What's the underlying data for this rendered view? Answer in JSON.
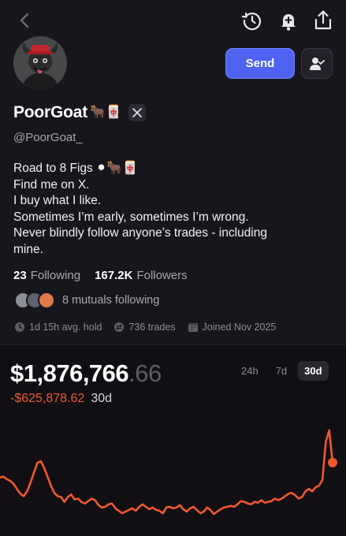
{
  "header": {
    "back_icon": "chevron-left-icon",
    "icons": [
      "history-icon",
      "bell-plus-icon",
      "share-icon"
    ]
  },
  "profile": {
    "display_name": "PoorGoat",
    "name_emojis": "🐂🀄",
    "handle": "@PoorGoat_",
    "bio": {
      "line1_text": "Road to 8 Figs",
      "line1_emojis": "⚫🐂🀄",
      "line2": "Find me on X.",
      "line3": "I buy what I like.",
      "line4": "Sometimes I’m early, sometimes I’m wrong.",
      "line5": "Never blindly follow anyone’s trades - including",
      "line6": "mine."
    },
    "following_count": "23",
    "following_label": "Following",
    "followers_count": "167.2K",
    "followers_label": "Followers",
    "mutuals_text": "8 mutuals following",
    "avg_hold": "1d 15h avg. hold",
    "trades": "736 trades",
    "joined": "Joined Nov 2025"
  },
  "actions": {
    "send_label": "Send"
  },
  "portfolio": {
    "balance_main": "$1,876,766",
    "balance_cents": ".66",
    "pnl_value": "-$625,878.62",
    "pnl_period": "30d",
    "ranges": [
      "24h",
      "7d",
      "30d"
    ],
    "active_range": "30d"
  },
  "colors": {
    "accent": "#4f63f0",
    "negative": "#f0592e",
    "background": "#18161d"
  },
  "chart_data": {
    "type": "area",
    "title": "",
    "xlabel": "",
    "ylabel": "",
    "period": "30d",
    "values": [
      2320000,
      2330000,
      2300000,
      2280000,
      2240000,
      2180000,
      2120000,
      2090000,
      2150000,
      2260000,
      2380000,
      2500000,
      2520000,
      2440000,
      2330000,
      2220000,
      2130000,
      2090000,
      2080000,
      2020000,
      2080000,
      2110000,
      2050000,
      2060000,
      2020000,
      2000000,
      2030000,
      2060000,
      2040000,
      1980000,
      1950000,
      1960000,
      1990000,
      2000000,
      1940000,
      1910000,
      1880000,
      1900000,
      1920000,
      1940000,
      1910000,
      1960000,
      1990000,
      1960000,
      1930000,
      1950000,
      1920000,
      1910000,
      1880000,
      1950000,
      1960000,
      1940000,
      1950000,
      1980000,
      1930000,
      1900000,
      1940000,
      1960000,
      1920000,
      1880000,
      1900000,
      1950000,
      1920000,
      1870000,
      1900000,
      1930000,
      1950000,
      1960000,
      1970000,
      1960000,
      1990000,
      2030000,
      2020000,
      2000000,
      1990000,
      2020000,
      2010000,
      2040000,
      2010000,
      2020000,
      2030000,
      2060000,
      2040000,
      2060000,
      2090000,
      2120000,
      2130000,
      2100000,
      2060000,
      2080000,
      2150000,
      2180000,
      2150000,
      2200000,
      2220000,
      2290000,
      2760000,
      2900000,
      2502644.62
    ],
    "current_value": 1876766.66
  }
}
